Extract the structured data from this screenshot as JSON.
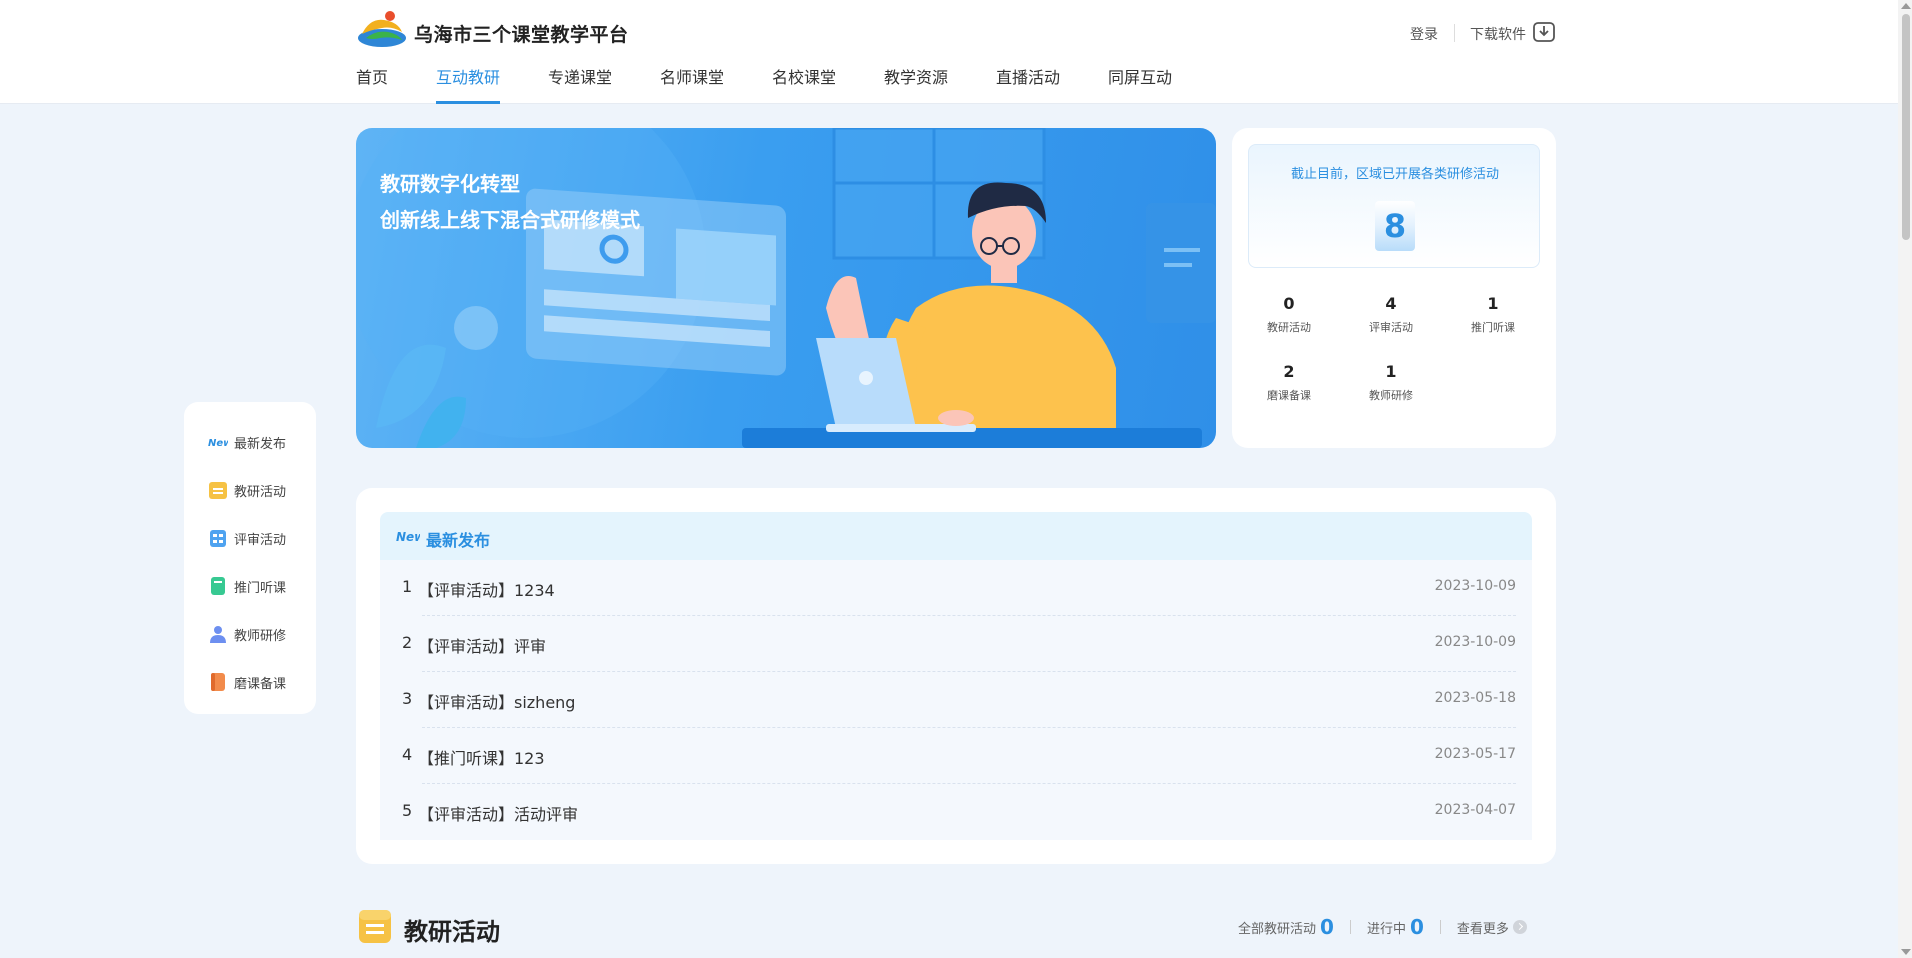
{
  "header": {
    "site_title": "乌海市三个课堂教学平台",
    "login": "登录",
    "download": "下载软件",
    "logo_icon": "platform-logo",
    "download_icon": "download-icon"
  },
  "nav": {
    "items": [
      {
        "label": "首页"
      },
      {
        "label": "互动教研",
        "active": true
      },
      {
        "label": "专递课堂"
      },
      {
        "label": "名师课堂"
      },
      {
        "label": "名校课堂"
      },
      {
        "label": "教学资源"
      },
      {
        "label": "直播活动"
      },
      {
        "label": "同屏互动"
      }
    ]
  },
  "side_menu": {
    "items": [
      {
        "label": "最新发布",
        "icon": "new-icon"
      },
      {
        "label": "教研活动",
        "icon": "folder-icon"
      },
      {
        "label": "评审活动",
        "icon": "clipboard-icon"
      },
      {
        "label": "推门听课",
        "icon": "book-icon"
      },
      {
        "label": "教师研修",
        "icon": "teacher-icon"
      },
      {
        "label": "磨课备课",
        "icon": "notebook-icon"
      }
    ]
  },
  "banner": {
    "line1": "教研数字化转型",
    "line2": "创新线上线下混合式研修模式"
  },
  "stats": {
    "caption": "截止目前，区域已开展各类研修活动",
    "total": "8",
    "items": [
      {
        "value": "0",
        "label": "教研活动"
      },
      {
        "value": "4",
        "label": "评审活动"
      },
      {
        "value": "1",
        "label": "推门听课"
      },
      {
        "value": "2",
        "label": "磨课备课"
      },
      {
        "value": "1",
        "label": "教师研修"
      }
    ]
  },
  "latest": {
    "title": "最新发布",
    "rows": [
      {
        "num": "1",
        "title": "【评审活动】1234",
        "date": "2023-10-09"
      },
      {
        "num": "2",
        "title": "【评审活动】评审",
        "date": "2023-10-09"
      },
      {
        "num": "3",
        "title": "【评审活动】sizheng",
        "date": "2023-05-18"
      },
      {
        "num": "4",
        "title": "【推门听课】123",
        "date": "2023-05-17"
      },
      {
        "num": "5",
        "title": "【评审活动】活动评审",
        "date": "2023-04-07"
      }
    ]
  },
  "section_research": {
    "title": "教研活动",
    "all_label": "全部教研活动",
    "all_count": "0",
    "ongoing_label": "进行中",
    "ongoing_count": "0",
    "more_label": "查看更多"
  },
  "colors": {
    "accent": "#2b8fe0",
    "page_bg": "#eef4fb",
    "banner": "#3a9ef0"
  }
}
